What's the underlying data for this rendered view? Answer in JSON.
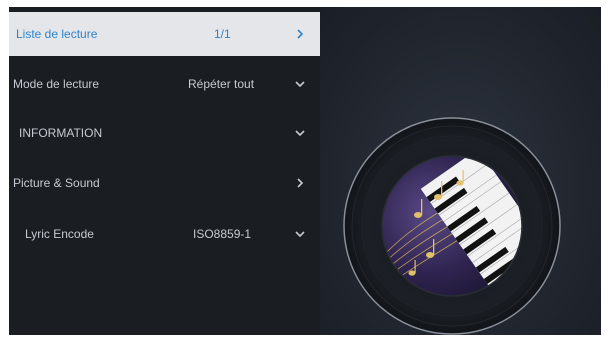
{
  "menu": {
    "items": [
      {
        "label": "Liste de lecture",
        "value": "1/1",
        "arrow": "chevron-right-icon",
        "active": true
      },
      {
        "label": "Mode de lecture",
        "value": "Répéter tout",
        "arrow": "chevron-down-icon",
        "active": false
      },
      {
        "label": "INFORMATION",
        "value": "",
        "arrow": "chevron-down-icon",
        "active": false
      },
      {
        "label": "Picture & Sound",
        "value": "",
        "arrow": "chevron-right-icon",
        "active": false
      },
      {
        "label": "Lyric Encode",
        "value": "ISO8859-1",
        "arrow": "chevron-down-icon",
        "active": false
      }
    ]
  },
  "player": {
    "disc_icon": "vinyl-record-icon",
    "artwork_icon": "music-notes-piano-artwork"
  },
  "colors": {
    "active_bg": "#e4e6ea",
    "active_text": "#2f83c9",
    "menu_text": "#c7cbd1",
    "screen_bg": "#1b1e24"
  }
}
